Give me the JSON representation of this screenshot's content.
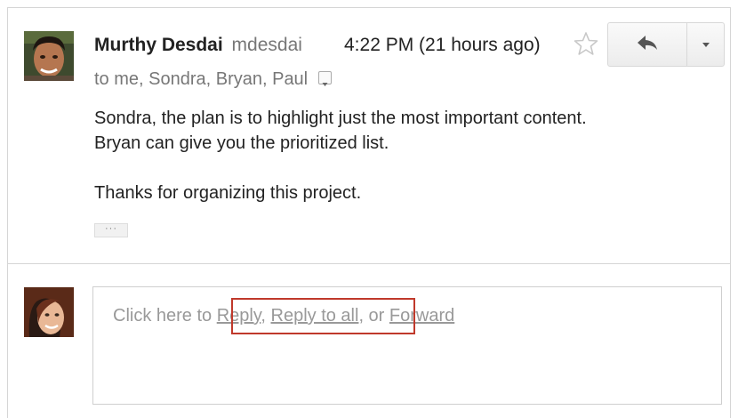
{
  "message": {
    "sender_name": "Murthy Desdai",
    "sender_email": "mdesdai",
    "timestamp": "4:22 PM (21 hours ago)",
    "recipients": "to me, Sondra, Bryan, Paul",
    "body_line_1": "Sondra, the plan is to highlight just the most important content.",
    "body_line_2": "Bryan can give you the prioritized list.",
    "body_line_3": "Thanks for organizing this project.",
    "trimmed_content_label": "···"
  },
  "toolbar": {
    "reply_icon": "reply-arrow-icon",
    "more_icon": "dropdown-arrow-icon",
    "star_icon": "star-outline-icon"
  },
  "reply": {
    "prompt_prefix": "Click here to ",
    "reply_label": "Reply",
    "sep_1": ", ",
    "reply_all_label": "Reply to all",
    "sep_2": ", or ",
    "forward_label": "Forward"
  },
  "colors": {
    "highlight_border": "#c0392b",
    "link_gray": "#999999",
    "text": "#222222"
  }
}
